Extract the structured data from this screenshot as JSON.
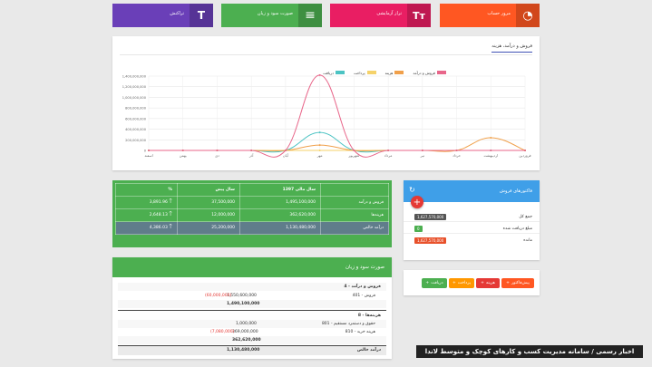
{
  "tiles": [
    {
      "label": "تراکنش",
      "color": "#6a3fb8",
      "icon": "T"
    },
    {
      "label": "صورت سود و زیان",
      "color": "#4caf50",
      "icon": "≡"
    },
    {
      "label": "تراز آزمایشی",
      "color": "#e91e63",
      "icon": "Tт"
    },
    {
      "label": "مرور حساب",
      "color": "#ff5722",
      "icon": "◔"
    }
  ],
  "chart_panel": {
    "tab": "فروش و درآمد، هزینه"
  },
  "chart_data": {
    "type": "line",
    "categories": [
      "فروردین",
      "اردیبهشت",
      "خرداد",
      "تیر",
      "مرداد",
      "شهریور",
      "مهر",
      "آبان",
      "آذر",
      "دی",
      "بهمن",
      "اسفند"
    ],
    "ylim": [
      0,
      1400000000
    ],
    "yticks": [
      "0",
      "200,000,000",
      "400,000,000",
      "600,000,000",
      "800,000,000",
      "1,000,000,000",
      "1,200,000,000",
      "1,400,000,000"
    ],
    "series": [
      {
        "name": "فروش و درآمد",
        "color": "#e8668a",
        "values": [
          0,
          0,
          0,
          0,
          0,
          0,
          1420000000,
          0,
          0,
          0,
          0,
          0
        ]
      },
      {
        "name": "هزینه",
        "color": "#f0a04b",
        "values": [
          0,
          240000000,
          0,
          0,
          0,
          0,
          100000000,
          0,
          0,
          0,
          0,
          0
        ]
      },
      {
        "name": "پرداخت",
        "color": "#f5d26a",
        "values": [
          0,
          0,
          0,
          0,
          0,
          0,
          0,
          0,
          0,
          0,
          0,
          0
        ]
      },
      {
        "name": "دریافت",
        "color": "#4cc3c3",
        "values": [
          0,
          0,
          0,
          0,
          0,
          0,
          340000000,
          0,
          0,
          0,
          0,
          0
        ]
      }
    ]
  },
  "summary": {
    "headers": [
      "",
      "سال مالی 1397",
      "سال پیش",
      "%"
    ],
    "rows": [
      {
        "label": "فروش و درآمد",
        "v1": "1,495,100,000",
        "v2": "37,500,000",
        "pct": "3,891.96"
      },
      {
        "label": "هزینه‌ها",
        "v1": "362,620,000",
        "v2": "12,000,000",
        "pct": "2,648.13"
      },
      {
        "label": "درآمد خالص",
        "v1": "1,130,480,000",
        "v2": "25,200,000",
        "pct": "4,386.03"
      }
    ]
  },
  "invoices": {
    "title": "فاکتورهای فروش",
    "rows": [
      {
        "label": "جمع کل",
        "value": "1,627,570,000",
        "color": "#555555"
      },
      {
        "label": "مبلغ دریافت شده",
        "value": "0",
        "color": "#4caf50"
      },
      {
        "label": "مانده",
        "value": "1,627,570,000",
        "color": "#e8502a"
      }
    ]
  },
  "actions": [
    {
      "label": "پیش‌فاکتور",
      "color": "#ff5722"
    },
    {
      "label": "هزینه",
      "color": "#e53935"
    },
    {
      "label": "پرداخت",
      "color": "#ff9800"
    },
    {
      "label": "دریافت",
      "color": "#4caf50"
    }
  ],
  "pl": {
    "title": "صورت سود و زیان",
    "income_header": "4 - فروش و درآمد",
    "income_line": {
      "label": "401 - فروش",
      "amount": "1,550,600,000",
      "deduction": "(60,000,000)"
    },
    "income_total": "1,490,100,000",
    "expense_header": "8 - هزینه‌ها",
    "expense_lines": [
      {
        "label": "801 - حقوق و دستمزد مستقیم",
        "amount": "1,000,000"
      },
      {
        "label": "810 - هزینه خرید",
        "amount": "369,000,000",
        "deduction": "(7,080,000)"
      }
    ],
    "expense_total": "362,620,000",
    "net_label": "درآمد خالص",
    "net_total": "1,130,480,000"
  },
  "watermark": "اخبار رسمی / سامانه مدیریت کسب و کارهای کوچک و متوسط لاندا"
}
